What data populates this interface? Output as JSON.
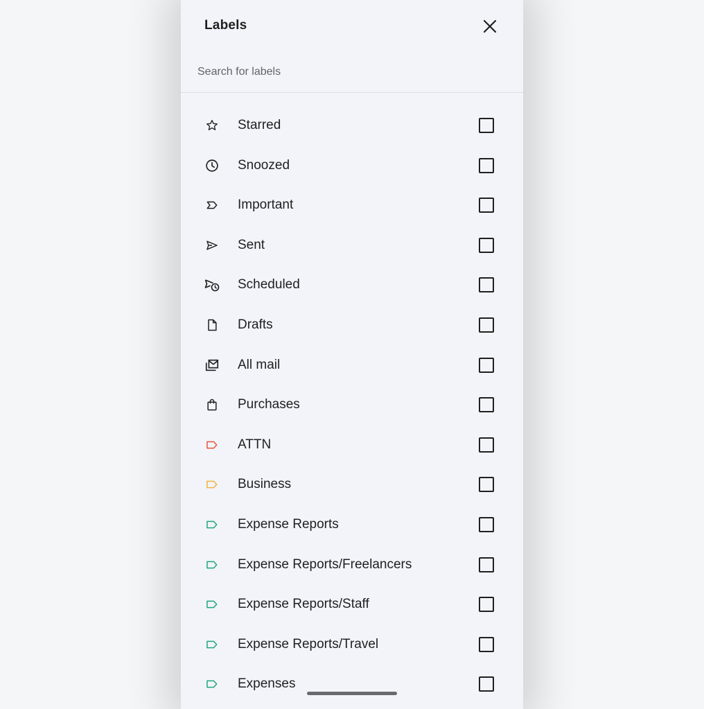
{
  "header": {
    "title": "Labels",
    "close_icon": "close-icon"
  },
  "search": {
    "placeholder": "Search for labels",
    "value": ""
  },
  "labels": [
    {
      "label": "Starred",
      "icon": "star-icon",
      "color": "#1f1f1f",
      "checked": false
    },
    {
      "label": "Snoozed",
      "icon": "clock-icon",
      "color": "#1f1f1f",
      "checked": false
    },
    {
      "label": "Important",
      "icon": "important-icon",
      "color": "#1f1f1f",
      "checked": false
    },
    {
      "label": "Sent",
      "icon": "send-icon",
      "color": "#1f1f1f",
      "checked": false
    },
    {
      "label": "Scheduled",
      "icon": "scheduled-send-icon",
      "color": "#1f1f1f",
      "checked": false
    },
    {
      "label": "Drafts",
      "icon": "draft-icon",
      "color": "#1f1f1f",
      "checked": false
    },
    {
      "label": "All mail",
      "icon": "all-mail-icon",
      "color": "#1f1f1f",
      "checked": false
    },
    {
      "label": "Purchases",
      "icon": "shopping-bag-icon",
      "color": "#1f1f1f",
      "checked": false
    },
    {
      "label": "ATTN",
      "icon": "label-tag-icon",
      "color": "#e5533d",
      "checked": false
    },
    {
      "label": "Business",
      "icon": "label-tag-icon",
      "color": "#f2b33d",
      "checked": false
    },
    {
      "label": "Expense Reports",
      "icon": "label-tag-icon",
      "color": "#1fa67a",
      "checked": false
    },
    {
      "label": "Expense Reports/Freelancers",
      "icon": "label-tag-icon",
      "color": "#1fa67a",
      "checked": false
    },
    {
      "label": "Expense Reports/Staff",
      "icon": "label-tag-icon",
      "color": "#1fa67a",
      "checked": false
    },
    {
      "label": "Expense Reports/Travel",
      "icon": "label-tag-icon",
      "color": "#1fa67a",
      "checked": false
    },
    {
      "label": "Expenses",
      "icon": "label-tag-icon",
      "color": "#1fa67a",
      "checked": false
    }
  ]
}
